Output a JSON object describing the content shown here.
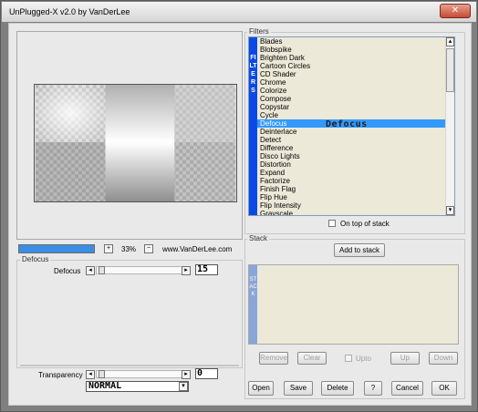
{
  "window": {
    "title": "UnPlugged-X v2.0 by VanDerLee",
    "close_label": "✕"
  },
  "preview": {
    "zoom_value": "33%",
    "website": "www.VanDerLee.com",
    "progress_fraction": 1.0
  },
  "defocus_group": {
    "label": "Defocus",
    "param_label": "Defocus",
    "param_value": "15"
  },
  "transparency": {
    "label": "Transparency",
    "value": "0"
  },
  "blend_mode": {
    "value": "NORMAL"
  },
  "filters": {
    "label": "Filters",
    "sidebar_text": "FILTERS",
    "items": [
      "Blades",
      "Blobspike",
      "Brighten Dark",
      "Cartoon Circles",
      "CD Shader",
      "Chrome",
      "Colorize",
      "Compose",
      "Copystar",
      "Cycle",
      "Defocus",
      "Deinterlace",
      "Detect",
      "Difference",
      "Disco Lights",
      "Distortion",
      "Expand",
      "Factorize",
      "Finish Flag",
      "Flip Hue",
      "Flip Intensity",
      "Gravscale"
    ],
    "selected": "Defocus",
    "selected_banner": "Defocus",
    "on_top_label": "On top of stack"
  },
  "stack": {
    "label": "Stack",
    "add_label": "Add to stack",
    "sidebar_text": "STACK",
    "remove_label": "Remove",
    "clear_label": "Clear",
    "upto_label": "Upto",
    "up_label": "Up",
    "down_label": "Down"
  },
  "footer": {
    "open": "Open",
    "save": "Save",
    "delete": "Delete",
    "help": "?",
    "cancel": "Cancel",
    "ok": "OK"
  }
}
